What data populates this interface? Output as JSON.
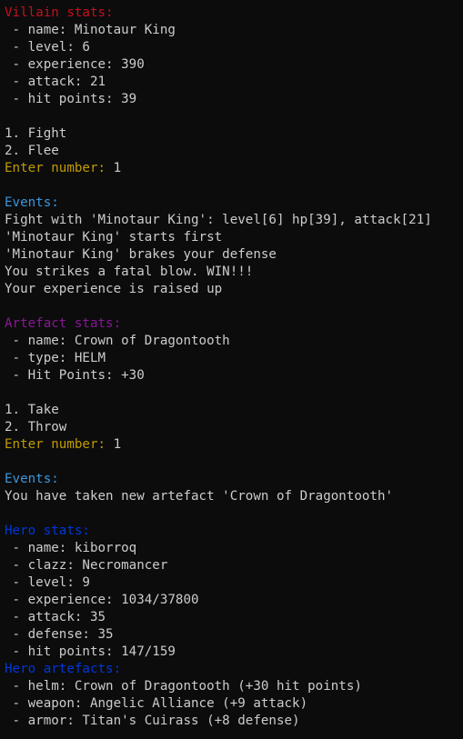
{
  "colors": {
    "background": "#0c0c0c",
    "text": "#cccccc",
    "villain_header": "#c50f1f",
    "prompt": "#c19c00",
    "events_header": "#3a96dd",
    "artefact_header": "#881798",
    "hero_header": "#0037da"
  },
  "villain": {
    "header": "Villain stats:",
    "name": " - name: Minotaur King",
    "level": " - level: 6",
    "experience": " - experience: 390",
    "attack": " - attack: 21",
    "hit_points": " - hit points: 39"
  },
  "fight_menu": {
    "option_1": "1. Fight",
    "option_2": "2. Flee",
    "prompt": "Enter number: ",
    "input": "1"
  },
  "fight_events": {
    "header": "Events:",
    "lines": [
      "Fight with 'Minotaur King': level[6] hp[39], attack[21]",
      "'Minotaur King' starts first",
      "'Minotaur King' brakes your defense",
      "You strikes a fatal blow. WIN!!!",
      "Your experience is raised up"
    ]
  },
  "artefact": {
    "header": "Artefact stats:",
    "name": " - name: Crown of Dragontooth",
    "type": " - type: HELM",
    "hit_points": " - Hit Points: +30"
  },
  "artefact_menu": {
    "option_1": "1. Take",
    "option_2": "2. Throw",
    "prompt": "Enter number: ",
    "input": "1"
  },
  "take_events": {
    "header": "Events:",
    "lines": [
      "You have taken new artefact 'Crown of Dragontooth'"
    ]
  },
  "hero": {
    "header": "Hero stats:",
    "name": " - name: kiborroq",
    "clazz": " - clazz: Necromancer",
    "level": " - level: 9",
    "experience": " - experience: 1034/37800",
    "attack": " - attack: 35",
    "defense": " - defense: 35",
    "hit_points": " - hit points: 147/159"
  },
  "hero_artefacts": {
    "header": "Hero artefacts:",
    "helm": " - helm: Crown of Dragontooth (+30 hit points)",
    "weapon": " - weapon: Angelic Alliance (+9 attack)",
    "armor": " - armor: Titan's Cuirass (+8 defense)"
  }
}
